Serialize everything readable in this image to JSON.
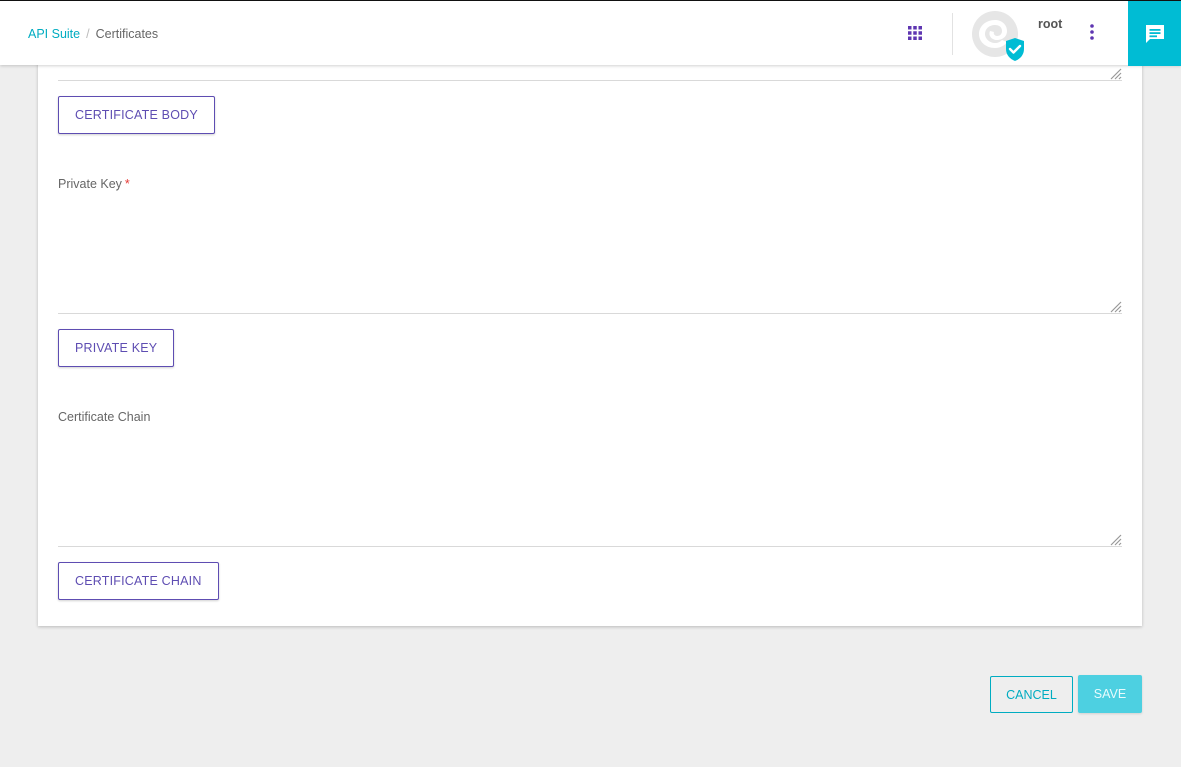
{
  "breadcrumb": {
    "root_label": "API Suite",
    "separator": "/",
    "current_label": "Certificates"
  },
  "header": {
    "username": "root",
    "apps_icon": "grid-apps-icon",
    "more_icon": "more-vertical-icon",
    "chat_icon": "chat-bubble-icon",
    "avatar_badge_icon": "verified-check-icon"
  },
  "form": {
    "certificate_body_button": "CERTIFICATE BODY",
    "private_key": {
      "label": "Private Key",
      "required_mark": "*",
      "value": "",
      "button": "PRIVATE KEY"
    },
    "certificate_chain": {
      "label": "Certificate Chain",
      "value": "",
      "button": "CERTIFICATE CHAIN"
    }
  },
  "actions": {
    "cancel_label": "CANCEL",
    "save_label": "SAVE"
  },
  "colors": {
    "accent": "#00acc1",
    "chat_button": "#00bcd4",
    "primary_purple": "#5e4db2",
    "save_button": "#4dd0e1",
    "required": "#e53935"
  }
}
